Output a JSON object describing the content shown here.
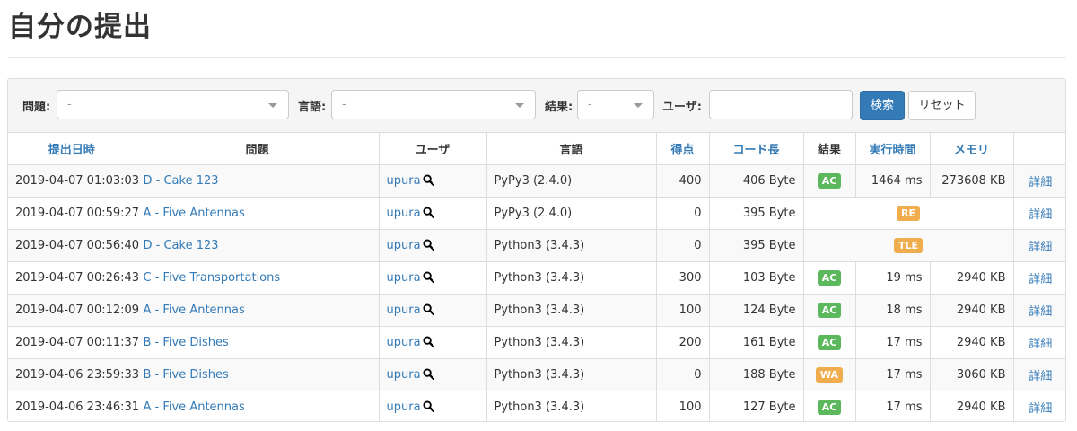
{
  "page": {
    "title": "自分の提出"
  },
  "filters": {
    "problem_label": "問題:",
    "problem_value": "-",
    "language_label": "言語:",
    "language_value": "-",
    "result_label": "結果:",
    "result_value": "-",
    "user_label": "ユーザ:",
    "user_value": "",
    "search_button": "検索",
    "reset_button": "リセット"
  },
  "table": {
    "headers": {
      "submitted_at": "提出日時",
      "problem": "問題",
      "user": "ユーザ",
      "language": "言語",
      "score": "得点",
      "code_length": "コード長",
      "result": "結果",
      "exec_time": "実行時間",
      "memory": "メモリ"
    },
    "rows": [
      {
        "time": "2019-04-07 01:03:03",
        "problem": "D - Cake 123",
        "user": "upura",
        "language": "PyPy3 (2.4.0)",
        "score": "400",
        "code_length": "406 Byte",
        "result": "AC",
        "exec_time": "1464 ms",
        "memory": "273608 KB",
        "detail": "詳細"
      },
      {
        "time": "2019-04-07 00:59:27",
        "problem": "A - Five Antennas",
        "user": "upura",
        "language": "PyPy3 (2.4.0)",
        "score": "0",
        "code_length": "395 Byte",
        "result": "RE",
        "exec_time": "",
        "memory": "",
        "detail": "詳細"
      },
      {
        "time": "2019-04-07 00:56:40",
        "problem": "D - Cake 123",
        "user": "upura",
        "language": "Python3 (3.4.3)",
        "score": "0",
        "code_length": "395 Byte",
        "result": "TLE",
        "exec_time": "",
        "memory": "",
        "detail": "詳細"
      },
      {
        "time": "2019-04-07 00:26:43",
        "problem": "C - Five Transportations",
        "user": "upura",
        "language": "Python3 (3.4.3)",
        "score": "300",
        "code_length": "103 Byte",
        "result": "AC",
        "exec_time": "19 ms",
        "memory": "2940 KB",
        "detail": "詳細"
      },
      {
        "time": "2019-04-07 00:12:09",
        "problem": "A - Five Antennas",
        "user": "upura",
        "language": "Python3 (3.4.3)",
        "score": "100",
        "code_length": "124 Byte",
        "result": "AC",
        "exec_time": "18 ms",
        "memory": "2940 KB",
        "detail": "詳細"
      },
      {
        "time": "2019-04-07 00:11:37",
        "problem": "B - Five Dishes",
        "user": "upura",
        "language": "Python3 (3.4.3)",
        "score": "200",
        "code_length": "161 Byte",
        "result": "AC",
        "exec_time": "17 ms",
        "memory": "2940 KB",
        "detail": "詳細"
      },
      {
        "time": "2019-04-06 23:59:33",
        "problem": "B - Five Dishes",
        "user": "upura",
        "language": "Python3 (3.4.3)",
        "score": "0",
        "code_length": "188 Byte",
        "result": "WA",
        "exec_time": "17 ms",
        "memory": "3060 KB",
        "detail": "詳細"
      },
      {
        "time": "2019-04-06 23:46:31",
        "problem": "A - Five Antennas",
        "user": "upura",
        "language": "Python3 (3.4.3)",
        "score": "100",
        "code_length": "127 Byte",
        "result": "AC",
        "exec_time": "17 ms",
        "memory": "2940 KB",
        "detail": "詳細"
      }
    ]
  },
  "colors": {
    "link": "#337ab7",
    "ac": "#5cb85c",
    "warn": "#f0ad4e"
  },
  "icons": {
    "user_search": "magnifier-icon"
  }
}
